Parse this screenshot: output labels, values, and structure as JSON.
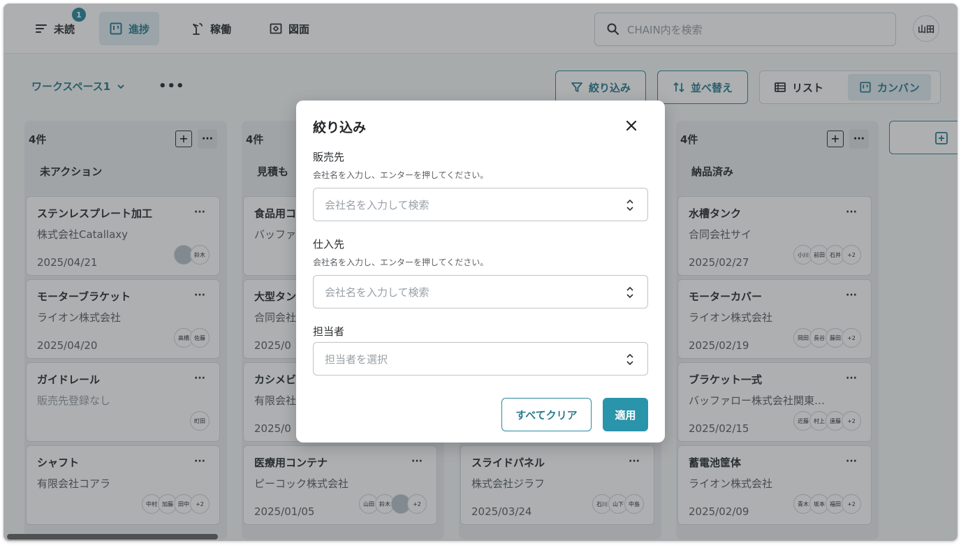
{
  "nav": {
    "tabs": [
      {
        "label": "未読",
        "icon": "filter-lines-icon"
      },
      {
        "label": "進捗",
        "icon": "kanban-icon"
      },
      {
        "label": "稼働",
        "icon": "lamp-icon"
      },
      {
        "label": "図面",
        "icon": "drawing-icon"
      }
    ],
    "unread_badge": "1",
    "search_placeholder": "CHAIN内を検索",
    "user_avatar": "山田"
  },
  "toolbar": {
    "workspace": "ワークスペース1",
    "filter_label": "絞り込み",
    "sort_label": "並べ替え",
    "view_list": "リスト",
    "view_kanban": "カンバン"
  },
  "columns": [
    {
      "count": "4件",
      "title": "未アクション",
      "cards": [
        {
          "title": "ステンレスプレート加工",
          "company": "株式会社Catallaxy",
          "date": "2025/04/21",
          "assignees": [
            "photo",
            "鈴木"
          ]
        },
        {
          "title": "モーターブラケット",
          "company": "ライオン株式会社",
          "date": "2025/04/20",
          "assignees": [
            "高橋",
            "佐藤"
          ]
        },
        {
          "title": "ガイドレール",
          "company": "販売先登録なし",
          "date": "",
          "assignees": [
            "町田"
          ]
        },
        {
          "title": "シャフト",
          "company": "有限会社コアラ",
          "date": "",
          "assignees": [
            "中村",
            "加藤",
            "田中",
            "+2"
          ]
        }
      ]
    },
    {
      "count": "4件",
      "title": "見積も",
      "cards": [
        {
          "title": "食品用コ",
          "company": "バッファ",
          "date": "",
          "assignees": []
        },
        {
          "title": "大型タン",
          "company": "合同会社",
          "date": "2025/0",
          "assignees": []
        },
        {
          "title": "カシメビ",
          "company": "有限会社",
          "date": "2025/0",
          "assignees": []
        },
        {
          "title": "医療用コンテナ",
          "company": "ピーコック株式会社",
          "date": "2025/01/05",
          "assignees": [
            "山田",
            "鈴木",
            "photo",
            "+2"
          ]
        }
      ]
    },
    {
      "count": "",
      "title": "",
      "cards": [
        {
          "title": "スライドパネル",
          "company": "株式会社ジラフ",
          "date": "2025/03/24",
          "assignees": [
            "石川",
            "山下",
            "中島"
          ]
        }
      ]
    },
    {
      "count": "4件",
      "title": "納品済み",
      "cards": [
        {
          "title": "水槽タンク",
          "company": "合同会社サイ",
          "date": "2025/02/27",
          "assignees": [
            "小川",
            "前田",
            "石井",
            "+2"
          ]
        },
        {
          "title": "モーターカバー",
          "company": "ライオン株式会社",
          "date": "2025/02/19",
          "assignees": [
            "岡田",
            "長谷",
            "藤田",
            "+2"
          ]
        },
        {
          "title": "ブラケット一式",
          "company": "バッファロー株式会社関東…",
          "date": "2025/02/15",
          "assignees": [
            "近藤",
            "村上",
            "遠藤",
            "+2"
          ]
        },
        {
          "title": "蓄電池筐体",
          "company": "ライオン株式会社",
          "date": "2025/02/09",
          "assignees": [
            "青木",
            "坂本",
            "福田",
            "+2"
          ]
        }
      ]
    }
  ],
  "modal": {
    "title": "絞り込み",
    "seller_label": "販売先",
    "seller_help": "会社名を入力し、エンターを押してください。",
    "seller_placeholder": "会社名を入力して検索",
    "supplier_label": "仕入先",
    "supplier_help": "会社名を入力し、エンターを押してください。",
    "supplier_placeholder": "会社名を入力して検索",
    "assignee_label": "担当者",
    "assignee_placeholder": "担当者を選択",
    "clear_label": "すべてクリア",
    "apply_label": "適用"
  },
  "colors": {
    "accent": "#2a8aa0",
    "apply": "#2a94ab",
    "overlay": "rgba(40,44,48,0.38)"
  }
}
